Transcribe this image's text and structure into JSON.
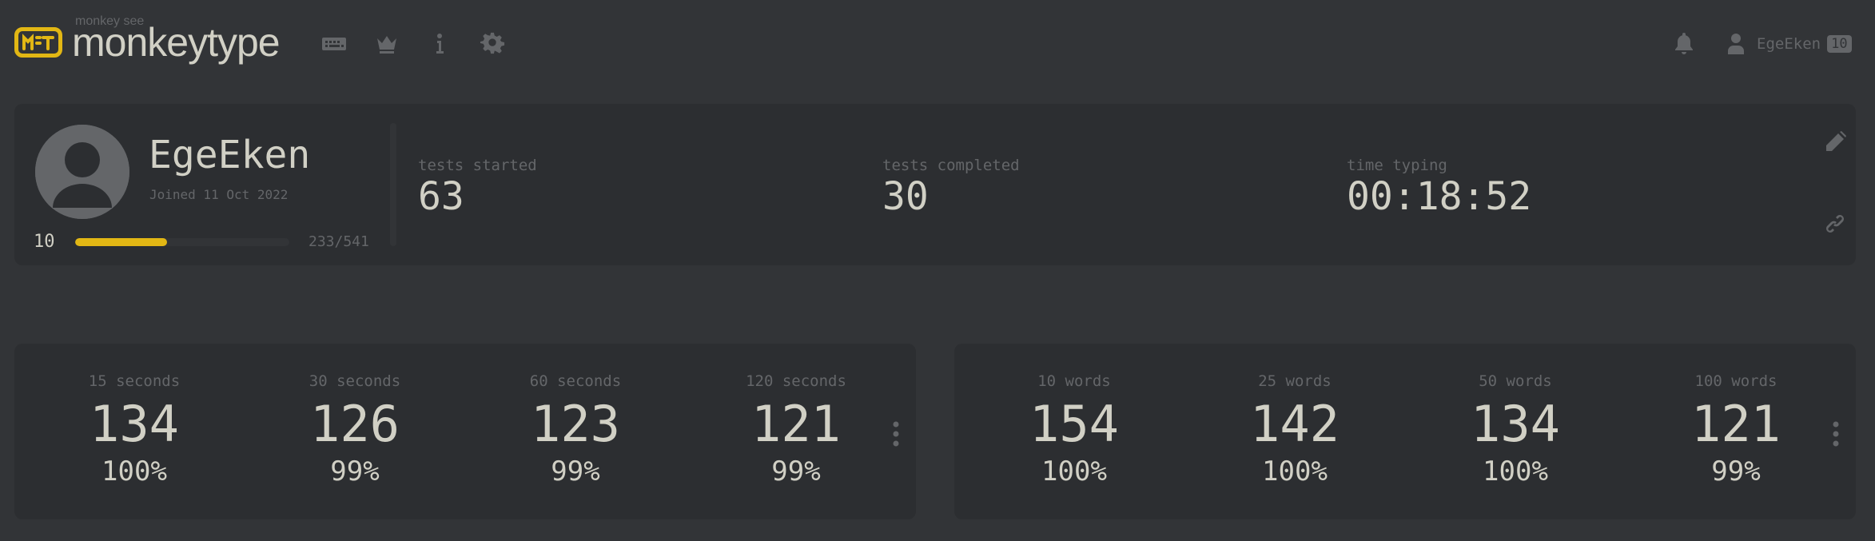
{
  "header": {
    "logo_sub": "monkey see",
    "logo_text": "monkeytype",
    "nav_icons": [
      "keyboard-icon",
      "crown-icon",
      "info-icon",
      "gear-icon"
    ],
    "account_name": "EgeEken",
    "account_level": "10"
  },
  "profile": {
    "username": "EgeEken",
    "joined": "Joined 11 Oct 2022",
    "level": "10",
    "xp_text": "233/541",
    "xp_fraction": 0.43,
    "stats": [
      {
        "label": "tests started",
        "value": "63"
      },
      {
        "label": "tests completed",
        "value": "30"
      },
      {
        "label": "time typing",
        "value": "00:18:52"
      }
    ]
  },
  "pb_time": [
    {
      "label": "15 seconds",
      "wpm": "134",
      "acc": "100%"
    },
    {
      "label": "30 seconds",
      "wpm": "126",
      "acc": "99%"
    },
    {
      "label": "60 seconds",
      "wpm": "123",
      "acc": "99%"
    },
    {
      "label": "120 seconds",
      "wpm": "121",
      "acc": "99%"
    }
  ],
  "pb_words": [
    {
      "label": "10 words",
      "wpm": "154",
      "acc": "100%"
    },
    {
      "label": "25 words",
      "wpm": "142",
      "acc": "100%"
    },
    {
      "label": "50 words",
      "wpm": "134",
      "acc": "100%"
    },
    {
      "label": "100 words",
      "wpm": "121",
      "acc": "99%"
    }
  ],
  "colors": {
    "accent": "#e2b714",
    "background": "#323437",
    "card": "#2c2e31",
    "text": "#d1d0c5",
    "sub": "#646669"
  }
}
